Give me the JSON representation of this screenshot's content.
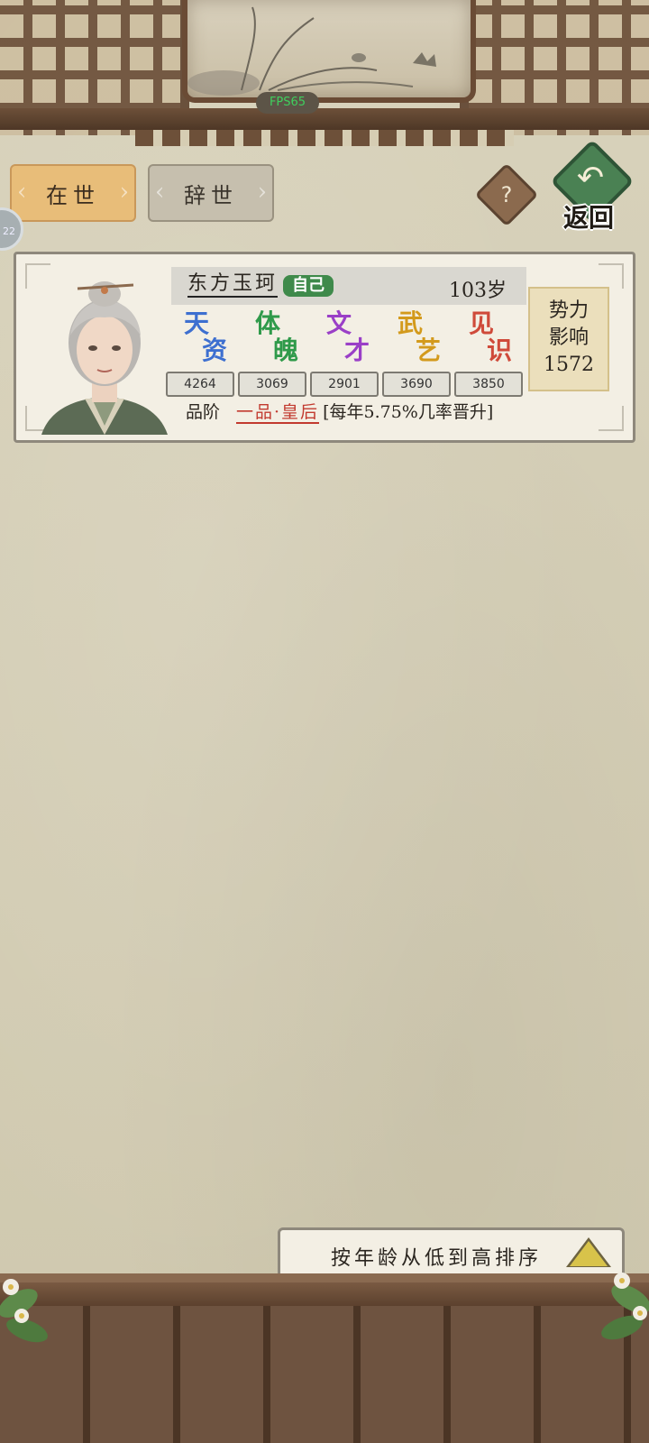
{
  "hud": {
    "fps": "FPS65",
    "side_badge": "22"
  },
  "tabs": [
    {
      "label": "在世",
      "active": true
    },
    {
      "label": "辞世",
      "active": false
    }
  ],
  "help": {
    "symbol": "?"
  },
  "back": {
    "label": "返回",
    "arrow": "↶"
  },
  "character": {
    "name": "东方玉珂",
    "tag": "自己",
    "age": "103岁",
    "stats": [
      {
        "label": "天资",
        "value": "4264",
        "color": "#3d6fd0"
      },
      {
        "label": "体魄",
        "value": "3069",
        "color": "#2f9a4a"
      },
      {
        "label": "文才",
        "value": "2901",
        "color": "#9a3fc7"
      },
      {
        "label": "武艺",
        "value": "3690",
        "color": "#d39a1c"
      },
      {
        "label": "见识",
        "value": "3850",
        "color": "#cf4a3a"
      }
    ],
    "rank": {
      "label": "品阶",
      "title": "一品·皇后",
      "note": "[每年5.75%几率晋升]"
    },
    "influence": {
      "line1": "势力",
      "line2": "影响",
      "value": "1572"
    }
  },
  "sort": {
    "label": "按年龄从低到高排序",
    "direction": "ascending"
  },
  "colors": {
    "accent_tab": "#e8bd79",
    "self_tag": "#3f8a4b",
    "rank_title": "#c23a2f",
    "back_button": "#4a8153"
  }
}
